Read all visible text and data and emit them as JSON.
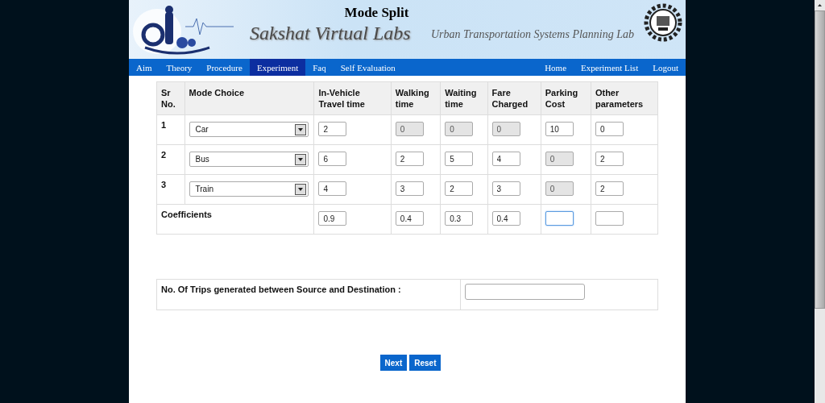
{
  "header": {
    "title": "Mode Split",
    "brand": "Sakshat Virtual Labs",
    "lab": "Urban Transportation Systems Planning Lab"
  },
  "nav": {
    "left": [
      {
        "label": "Aim",
        "selected": false
      },
      {
        "label": "Theory",
        "selected": false
      },
      {
        "label": "Procedure",
        "selected": false
      },
      {
        "label": "Experiment",
        "selected": true
      },
      {
        "label": "Faq",
        "selected": false
      },
      {
        "label": "Self Evaluation",
        "selected": false
      }
    ],
    "right": [
      {
        "label": "Home",
        "selected": false
      },
      {
        "label": "Experiment List",
        "selected": false
      },
      {
        "label": "Logout",
        "selected": false
      }
    ]
  },
  "table": {
    "columns": [
      "Sr No.",
      "Mode Choice",
      "In-Vehicle Travel time",
      "Walking time",
      "Waiting time",
      "Fare Charged",
      "Parking Cost",
      "Other parameters"
    ],
    "rows": [
      {
        "cells": [
          {
            "kind": "text",
            "value": "1"
          },
          {
            "kind": "dropdown",
            "value": "Car"
          },
          {
            "value": "2",
            "disabled": false
          },
          {
            "value": "0",
            "disabled": true
          },
          {
            "value": "0",
            "disabled": true
          },
          {
            "value": "0",
            "disabled": true
          },
          {
            "value": "10",
            "disabled": false
          },
          {
            "value": "0",
            "disabled": false
          }
        ]
      },
      {
        "cells": [
          {
            "kind": "text",
            "value": "2"
          },
          {
            "kind": "dropdown",
            "value": "Bus"
          },
          {
            "value": "6",
            "disabled": false
          },
          {
            "value": "2",
            "disabled": false
          },
          {
            "value": "5",
            "disabled": false
          },
          {
            "value": "4",
            "disabled": false
          },
          {
            "value": "0",
            "disabled": true
          },
          {
            "value": "2",
            "disabled": false
          }
        ]
      },
      {
        "cells": [
          {
            "kind": "text",
            "value": "3"
          },
          {
            "kind": "dropdown",
            "value": "Train"
          },
          {
            "value": "4",
            "disabled": false
          },
          {
            "value": "3",
            "disabled": false
          },
          {
            "value": "2",
            "disabled": false
          },
          {
            "value": "3",
            "disabled": false
          },
          {
            "value": "0",
            "disabled": true
          },
          {
            "value": "2",
            "disabled": false
          }
        ]
      }
    ],
    "coefficients": {
      "label": "Coefficients",
      "cells": [
        {
          "value": "0.9",
          "focused": false
        },
        {
          "value": "0.4",
          "focused": false
        },
        {
          "value": "0.3",
          "focused": false
        },
        {
          "value": "0.4",
          "focused": false
        },
        {
          "focused": true
        },
        {
          "focused": false
        }
      ]
    }
  },
  "trips": {
    "label": "No. Of Trips generated between Source and Destination :"
  },
  "buttons": [
    "Next",
    "Reset"
  ]
}
